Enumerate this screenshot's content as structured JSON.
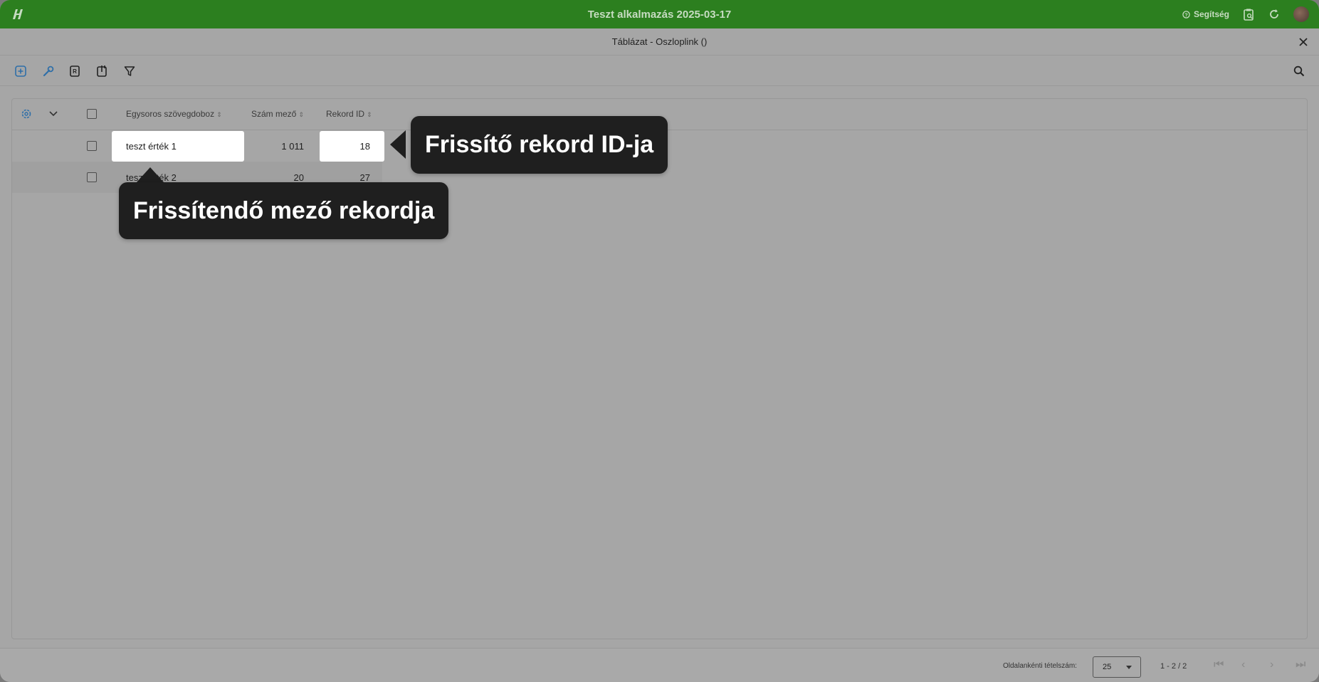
{
  "app": {
    "title": "Teszt alkalmazás 2025-03-17",
    "help_label": "Segítség",
    "accent": "#2c7f1f"
  },
  "subheader": {
    "title": "Táblázat - Oszloplink ()"
  },
  "toolbar": {
    "icons": [
      "add-icon",
      "wrench-icon",
      "export-icon",
      "import-icon",
      "filter-icon",
      "search-icon"
    ]
  },
  "table": {
    "columns": [
      "Egysoros szövegdoboz",
      "Szám mező",
      "Rekord ID"
    ],
    "rows": [
      {
        "text": "teszt érték 1",
        "number": "1 011",
        "record_id": "18"
      },
      {
        "text": "teszt érték 2",
        "number": "20",
        "record_id": "27"
      }
    ]
  },
  "footer": {
    "per_page_label": "Oldalankénti tételszám:",
    "per_page_value": "25",
    "range": "1 - 2 / 2"
  },
  "callouts": {
    "record_id": "Frissítő rekord ID-ja",
    "field_record": "Frissítendő mező rekordja"
  }
}
